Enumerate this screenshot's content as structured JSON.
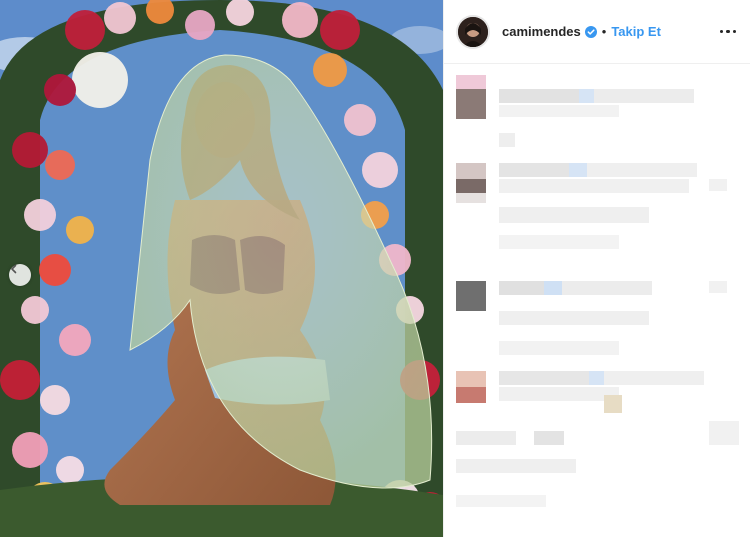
{
  "header": {
    "username": "camimendes",
    "separator": "•",
    "follow_label": "Takip Et"
  },
  "icons": {
    "verified": "verified-badge-icon",
    "more": "more-options-icon",
    "prev": "chevron-left-icon"
  },
  "colors": {
    "link": "#3897f0",
    "text": "#262626",
    "border": "#efefef"
  }
}
